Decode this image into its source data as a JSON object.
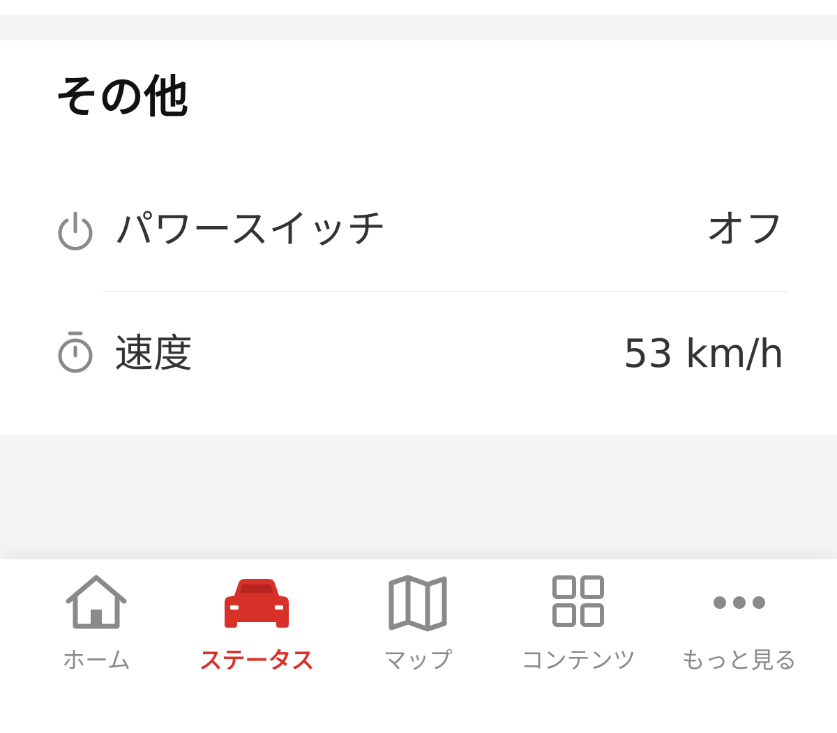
{
  "section": {
    "title": "その他"
  },
  "rows": [
    {
      "icon": "power-icon",
      "label": "パワースイッチ",
      "value": "オフ"
    },
    {
      "icon": "stopwatch-icon",
      "label": "速度",
      "value": "53 km/h"
    }
  ],
  "tabbar": {
    "items": [
      {
        "icon": "home-icon",
        "label": "ホーム",
        "active": false
      },
      {
        "icon": "car-icon",
        "label": "ステータス",
        "active": true
      },
      {
        "icon": "map-icon",
        "label": "マップ",
        "active": false
      },
      {
        "icon": "grid-icon",
        "label": "コンテンツ",
        "active": false
      },
      {
        "icon": "more-dots-icon",
        "label": "もっと見る",
        "active": false
      }
    ]
  },
  "colors": {
    "accent": "#d8312a",
    "icon_gray": "#8a8a8a",
    "background": "#f5f5f5",
    "card": "#ffffff"
  }
}
